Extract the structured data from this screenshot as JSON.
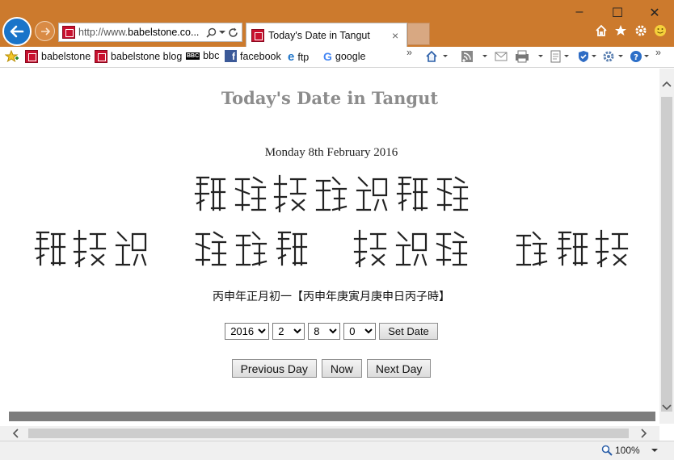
{
  "browser": {
    "address": {
      "prefix": "http://www.",
      "domain": "babelstone.co..."
    },
    "tab": {
      "title": "Today's Date in Tangut"
    },
    "favorites": [
      "babelstone",
      "babelstone blog",
      "bbc",
      "facebook",
      "ftp",
      "google"
    ],
    "zoom": "100%",
    "colors": {
      "chrome": "#cc7a2d",
      "back_button": "#1a74c9"
    }
  },
  "page": {
    "title": "Today's Date in Tangut",
    "date_text": "Monday 8th February 2016",
    "chinese_date": "丙申年正月初一【丙申年庚寅月庚申日丙子時】",
    "controls": {
      "year": "2016",
      "month": "2",
      "day": "8",
      "hour": "0",
      "set_date": "Set Date",
      "previous_day": "Previous Day",
      "now": "Now",
      "next_day": "Next Day"
    }
  }
}
